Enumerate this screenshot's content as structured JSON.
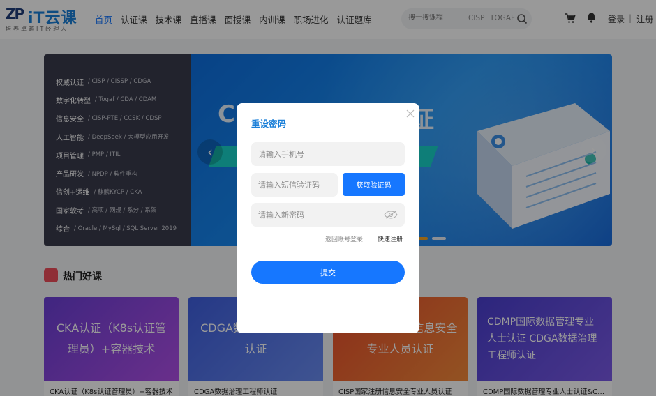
{
  "header": {
    "logo_mark": "ZP",
    "logo_text": "iT云课",
    "logo_sub": "培养卓越IT经理人",
    "nav": [
      {
        "label": "首页",
        "active": true
      },
      {
        "label": "认证课"
      },
      {
        "label": "技术课"
      },
      {
        "label": "直播课"
      },
      {
        "label": "面授课"
      },
      {
        "label": "内训课"
      },
      {
        "label": "职场进化"
      },
      {
        "label": "认证题库"
      }
    ],
    "search_placeholder": "搜一搜课程",
    "search_tags": [
      "CISP",
      "TOGAF"
    ],
    "login": "登录",
    "separator": "|",
    "register": "注册"
  },
  "categories": [
    {
      "title": "权威认证",
      "links": "/ CISP / CISSP / CDGA"
    },
    {
      "title": "数字化转型",
      "links": "/ Togaf / CDA / CDAM"
    },
    {
      "title": "信息安全",
      "links": "/ CISP-PTE / CCSK / CDSP"
    },
    {
      "title": "人工智能",
      "links": "/ DeepSeek / 大模型应用开发"
    },
    {
      "title": "项目管理",
      "links": "/ PMP / ITIL"
    },
    {
      "title": "产品研发",
      "links": "/ NPDP / 软件重构"
    },
    {
      "title": "信创+运维",
      "links": "/ 麒麟KYCP / CKA"
    },
    {
      "title": "国家软考",
      "links": "/ 高项 / 网规 / 系分 / 系架"
    },
    {
      "title": "综合",
      "links": "/ Oracle / MySql / SQL Server 2019"
    }
  ],
  "banner": {
    "title_left": "C",
    "title_right": "证"
  },
  "hot": {
    "title": "热门好课",
    "cards": [
      {
        "image_text": "CKA认证（K8s认证管理员）+容器技术",
        "caption": "CKA认证（K8s认证管理员）+容器技术",
        "color": "#7a3fd6"
      },
      {
        "image_text": "CDGA数据治理工程师认证",
        "caption": "CDGA数据治理工程师认证",
        "color": "#4a5fe0"
      },
      {
        "image_text": "CISP国家注册信息安全专业人员认证",
        "caption": "CISP国家注册信息安全专业人员认证",
        "color": "#f2612e"
      },
      {
        "image_text": "CDMP国际数据管理专业人士认证 CDGA数据治理工程师认证",
        "caption": "CDMP国际数据管理专业人士认证&CD...",
        "color": "#5a4fd8"
      }
    ]
  },
  "modal": {
    "title": "重设密码",
    "phone_placeholder": "请输入手机号",
    "sms_placeholder": "请输入短信验证码",
    "get_code": "获取验证码",
    "password_placeholder": "请输入新密码",
    "back_login": "返回账号登录",
    "quick_register": "快速注册",
    "submit": "提交"
  },
  "colors": {
    "accent": "#1677ff",
    "category_bg": "#3a3b4b"
  }
}
